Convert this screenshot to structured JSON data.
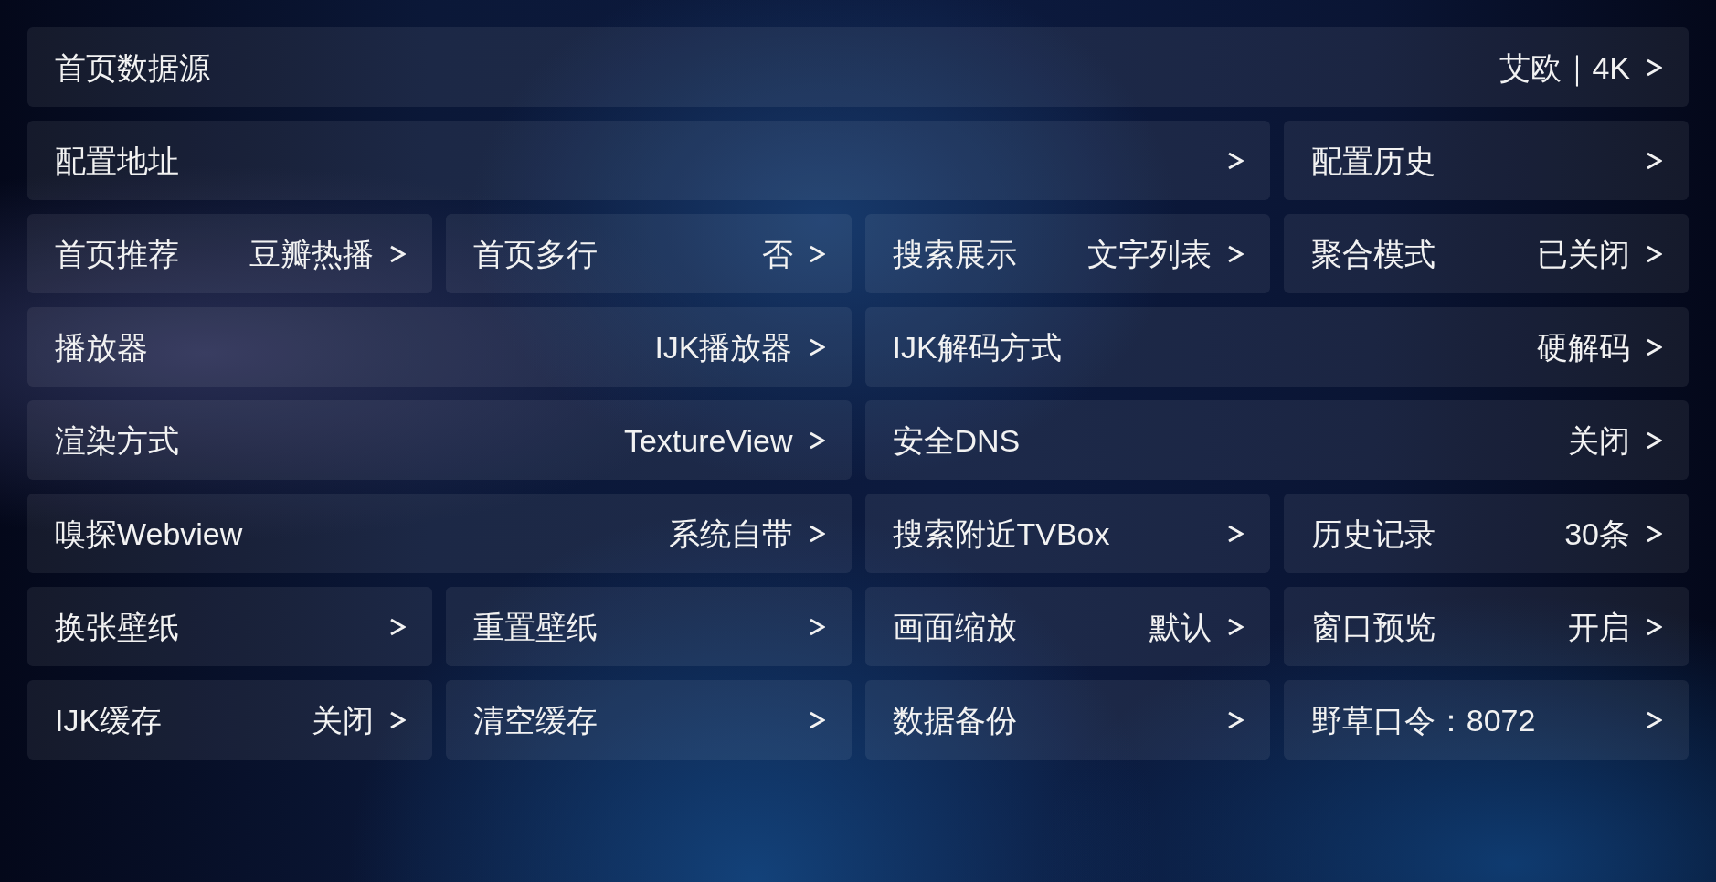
{
  "settings": {
    "rows": [
      {
        "items": [
          {
            "label": "首页数据源",
            "value": "艾欧｜4K"
          }
        ]
      },
      {
        "items": [
          {
            "label": "配置地址"
          },
          {
            "label": "配置历史"
          }
        ]
      },
      {
        "items": [
          {
            "label": "首页推荐",
            "value": "豆瓣热播"
          },
          {
            "label": "首页多行",
            "value": "否"
          },
          {
            "label": "搜索展示",
            "value": "文字列表"
          },
          {
            "label": "聚合模式",
            "value": "已关闭"
          }
        ]
      },
      {
        "items": [
          {
            "label": "播放器",
            "value": "IJK播放器"
          },
          {
            "label": "IJK解码方式",
            "value": "硬解码"
          }
        ]
      },
      {
        "items": [
          {
            "label": "渲染方式",
            "value": "TextureView"
          },
          {
            "label": "安全DNS",
            "value": "关闭"
          }
        ]
      },
      {
        "items": [
          {
            "label": "嗅探Webview",
            "value": "系统自带"
          },
          {
            "label": "搜索附近TVBox"
          },
          {
            "label": "历史记录",
            "value": "30条"
          }
        ]
      },
      {
        "items": [
          {
            "label": "换张壁纸"
          },
          {
            "label": "重置壁纸"
          },
          {
            "label": "画面缩放",
            "value": "默认"
          },
          {
            "label": "窗口预览",
            "value": "开启"
          }
        ]
      },
      {
        "items": [
          {
            "label": "IJK缓存",
            "value": "关闭"
          },
          {
            "label": "清空缓存"
          },
          {
            "label": "数据备份"
          },
          {
            "label": "野草口令：8072"
          }
        ]
      }
    ]
  }
}
